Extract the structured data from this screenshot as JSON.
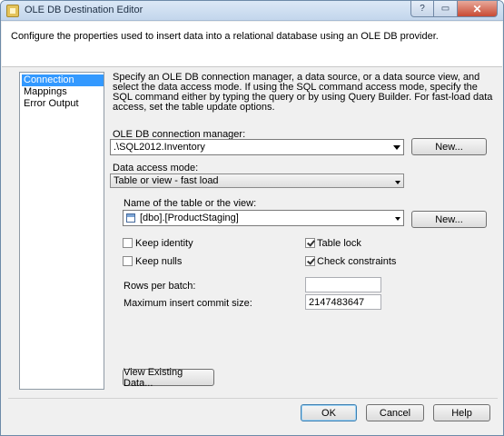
{
  "window": {
    "title": "OLE DB Destination Editor"
  },
  "header": {
    "text": "Configure the properties used to insert data into a relational database using an OLE DB provider."
  },
  "nav": {
    "items": [
      "Connection Manager",
      "Mappings",
      "Error Output"
    ]
  },
  "main": {
    "description": "Specify an OLE DB connection manager, a data source, or a data source view, and select the data access mode. If using the SQL command access mode, specify the SQL command either by typing the query or by using Query Builder. For fast-load data access, set the table update options.",
    "connection_label": "OLE DB connection manager:",
    "connection_value": ".\\SQL2012.Inventory",
    "new_label": "New...",
    "access_mode_label": "Data access mode:",
    "access_mode_value": "Table or view - fast load",
    "table_label": "Name of the table or the view:",
    "table_value": "[dbo].[ProductStaging]",
    "new2_label": "New...",
    "keep_identity": "Keep identity",
    "table_lock": "Table lock",
    "keep_nulls": "Keep nulls",
    "check_constraints": "Check constraints",
    "rows_per_batch_label": "Rows per batch:",
    "rows_per_batch_value": "",
    "max_commit_label": "Maximum insert commit size:",
    "max_commit_value": "2147483647",
    "view_data_label": "View Existing Data..."
  },
  "footer": {
    "ok": "OK",
    "cancel": "Cancel",
    "help": "Help"
  }
}
